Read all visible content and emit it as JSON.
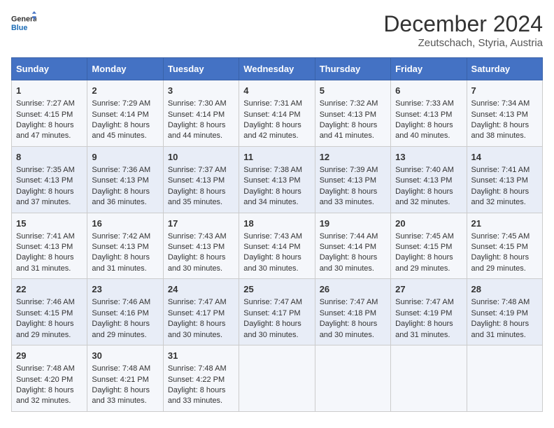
{
  "logo": {
    "line1": "General",
    "line2": "Blue"
  },
  "title": "December 2024",
  "subtitle": "Zeutschach, Styria, Austria",
  "days_of_week": [
    "Sunday",
    "Monday",
    "Tuesday",
    "Wednesday",
    "Thursday",
    "Friday",
    "Saturday"
  ],
  "weeks": [
    [
      {
        "day": "1",
        "sunrise": "Sunrise: 7:27 AM",
        "sunset": "Sunset: 4:15 PM",
        "daylight": "Daylight: 8 hours and 47 minutes."
      },
      {
        "day": "2",
        "sunrise": "Sunrise: 7:29 AM",
        "sunset": "Sunset: 4:14 PM",
        "daylight": "Daylight: 8 hours and 45 minutes."
      },
      {
        "day": "3",
        "sunrise": "Sunrise: 7:30 AM",
        "sunset": "Sunset: 4:14 PM",
        "daylight": "Daylight: 8 hours and 44 minutes."
      },
      {
        "day": "4",
        "sunrise": "Sunrise: 7:31 AM",
        "sunset": "Sunset: 4:14 PM",
        "daylight": "Daylight: 8 hours and 42 minutes."
      },
      {
        "day": "5",
        "sunrise": "Sunrise: 7:32 AM",
        "sunset": "Sunset: 4:13 PM",
        "daylight": "Daylight: 8 hours and 41 minutes."
      },
      {
        "day": "6",
        "sunrise": "Sunrise: 7:33 AM",
        "sunset": "Sunset: 4:13 PM",
        "daylight": "Daylight: 8 hours and 40 minutes."
      },
      {
        "day": "7",
        "sunrise": "Sunrise: 7:34 AM",
        "sunset": "Sunset: 4:13 PM",
        "daylight": "Daylight: 8 hours and 38 minutes."
      }
    ],
    [
      {
        "day": "8",
        "sunrise": "Sunrise: 7:35 AM",
        "sunset": "Sunset: 4:13 PM",
        "daylight": "Daylight: 8 hours and 37 minutes."
      },
      {
        "day": "9",
        "sunrise": "Sunrise: 7:36 AM",
        "sunset": "Sunset: 4:13 PM",
        "daylight": "Daylight: 8 hours and 36 minutes."
      },
      {
        "day": "10",
        "sunrise": "Sunrise: 7:37 AM",
        "sunset": "Sunset: 4:13 PM",
        "daylight": "Daylight: 8 hours and 35 minutes."
      },
      {
        "day": "11",
        "sunrise": "Sunrise: 7:38 AM",
        "sunset": "Sunset: 4:13 PM",
        "daylight": "Daylight: 8 hours and 34 minutes."
      },
      {
        "day": "12",
        "sunrise": "Sunrise: 7:39 AM",
        "sunset": "Sunset: 4:13 PM",
        "daylight": "Daylight: 8 hours and 33 minutes."
      },
      {
        "day": "13",
        "sunrise": "Sunrise: 7:40 AM",
        "sunset": "Sunset: 4:13 PM",
        "daylight": "Daylight: 8 hours and 32 minutes."
      },
      {
        "day": "14",
        "sunrise": "Sunrise: 7:41 AM",
        "sunset": "Sunset: 4:13 PM",
        "daylight": "Daylight: 8 hours and 32 minutes."
      }
    ],
    [
      {
        "day": "15",
        "sunrise": "Sunrise: 7:41 AM",
        "sunset": "Sunset: 4:13 PM",
        "daylight": "Daylight: 8 hours and 31 minutes."
      },
      {
        "day": "16",
        "sunrise": "Sunrise: 7:42 AM",
        "sunset": "Sunset: 4:13 PM",
        "daylight": "Daylight: 8 hours and 31 minutes."
      },
      {
        "day": "17",
        "sunrise": "Sunrise: 7:43 AM",
        "sunset": "Sunset: 4:13 PM",
        "daylight": "Daylight: 8 hours and 30 minutes."
      },
      {
        "day": "18",
        "sunrise": "Sunrise: 7:43 AM",
        "sunset": "Sunset: 4:14 PM",
        "daylight": "Daylight: 8 hours and 30 minutes."
      },
      {
        "day": "19",
        "sunrise": "Sunrise: 7:44 AM",
        "sunset": "Sunset: 4:14 PM",
        "daylight": "Daylight: 8 hours and 30 minutes."
      },
      {
        "day": "20",
        "sunrise": "Sunrise: 7:45 AM",
        "sunset": "Sunset: 4:15 PM",
        "daylight": "Daylight: 8 hours and 29 minutes."
      },
      {
        "day": "21",
        "sunrise": "Sunrise: 7:45 AM",
        "sunset": "Sunset: 4:15 PM",
        "daylight": "Daylight: 8 hours and 29 minutes."
      }
    ],
    [
      {
        "day": "22",
        "sunrise": "Sunrise: 7:46 AM",
        "sunset": "Sunset: 4:15 PM",
        "daylight": "Daylight: 8 hours and 29 minutes."
      },
      {
        "day": "23",
        "sunrise": "Sunrise: 7:46 AM",
        "sunset": "Sunset: 4:16 PM",
        "daylight": "Daylight: 8 hours and 29 minutes."
      },
      {
        "day": "24",
        "sunrise": "Sunrise: 7:47 AM",
        "sunset": "Sunset: 4:17 PM",
        "daylight": "Daylight: 8 hours and 30 minutes."
      },
      {
        "day": "25",
        "sunrise": "Sunrise: 7:47 AM",
        "sunset": "Sunset: 4:17 PM",
        "daylight": "Daylight: 8 hours and 30 minutes."
      },
      {
        "day": "26",
        "sunrise": "Sunrise: 7:47 AM",
        "sunset": "Sunset: 4:18 PM",
        "daylight": "Daylight: 8 hours and 30 minutes."
      },
      {
        "day": "27",
        "sunrise": "Sunrise: 7:47 AM",
        "sunset": "Sunset: 4:19 PM",
        "daylight": "Daylight: 8 hours and 31 minutes."
      },
      {
        "day": "28",
        "sunrise": "Sunrise: 7:48 AM",
        "sunset": "Sunset: 4:19 PM",
        "daylight": "Daylight: 8 hours and 31 minutes."
      }
    ],
    [
      {
        "day": "29",
        "sunrise": "Sunrise: 7:48 AM",
        "sunset": "Sunset: 4:20 PM",
        "daylight": "Daylight: 8 hours and 32 minutes."
      },
      {
        "day": "30",
        "sunrise": "Sunrise: 7:48 AM",
        "sunset": "Sunset: 4:21 PM",
        "daylight": "Daylight: 8 hours and 33 minutes."
      },
      {
        "day": "31",
        "sunrise": "Sunrise: 7:48 AM",
        "sunset": "Sunset: 4:22 PM",
        "daylight": "Daylight: 8 hours and 33 minutes."
      },
      {
        "day": "",
        "sunrise": "",
        "sunset": "",
        "daylight": ""
      },
      {
        "day": "",
        "sunrise": "",
        "sunset": "",
        "daylight": ""
      },
      {
        "day": "",
        "sunrise": "",
        "sunset": "",
        "daylight": ""
      },
      {
        "day": "",
        "sunrise": "",
        "sunset": "",
        "daylight": ""
      }
    ]
  ]
}
